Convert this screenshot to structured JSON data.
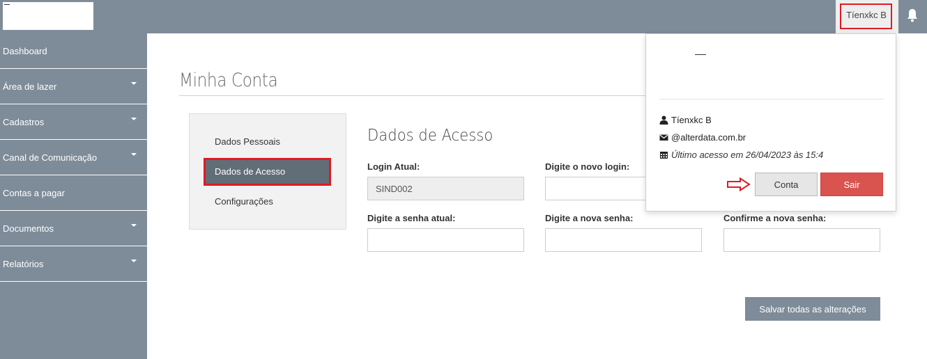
{
  "header": {
    "user_name": "Tíenxkc B",
    "bell_icon": "bell-icon",
    "colors": {
      "bar": "#7e8c99",
      "highlight": "#e01a22"
    }
  },
  "sidebar": {
    "items": [
      {
        "label": "Dashboard",
        "has_caret": false
      },
      {
        "label": "Área de lazer",
        "has_caret": true
      },
      {
        "label": "Cadastros",
        "has_caret": true
      },
      {
        "label": "Canal de Comunicação",
        "has_caret": true
      },
      {
        "label": "Contas a pagar",
        "has_caret": false
      },
      {
        "label": "Documentos",
        "has_caret": true
      },
      {
        "label": "Relatórios",
        "has_caret": true
      }
    ]
  },
  "main": {
    "page_title": "Minha Conta",
    "tabs": [
      {
        "label": "Dados Pessoais",
        "active": false
      },
      {
        "label": "Dados de Acesso",
        "active": true
      },
      {
        "label": "Configurações",
        "active": false
      }
    ],
    "section_title": "Dados de Acesso",
    "fields": {
      "login_atual": {
        "label": "Login Atual:",
        "value": "SIND002"
      },
      "novo_login": {
        "label": "Digite o novo login:",
        "value": ""
      },
      "senha_atual": {
        "label": "Digite a senha atual:",
        "value": ""
      },
      "nova_senha": {
        "label": "Digite a nova senha:",
        "value": ""
      },
      "confirme_senha": {
        "label": "Confirme a nova senha:",
        "value": ""
      }
    },
    "save_label": "Salvar todas as alterações"
  },
  "dropdown": {
    "name": "Tíenxkc B",
    "email": "@alterdata.com.br",
    "last_access": "Último acesso em 26/04/2023 às 15:4",
    "conta_label": "Conta",
    "sair_label": "Sair",
    "sair_color": "#d9534f"
  }
}
